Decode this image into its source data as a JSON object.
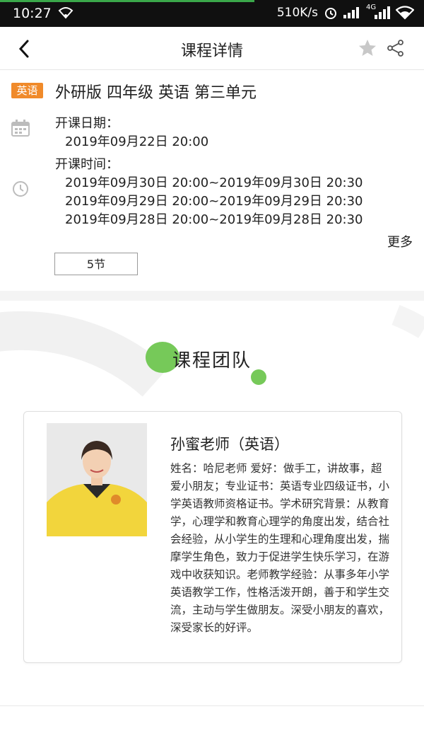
{
  "status_bar": {
    "time": "10:27",
    "network_speed": "510K/s",
    "signal_type": "4G",
    "icons": [
      "wifi-icon",
      "alarm-icon",
      "signal-icon",
      "signal-4g-icon",
      "wifi-icon"
    ]
  },
  "header": {
    "title": "课程详情",
    "back_icon": "chevron-left-icon",
    "favorite_icon": "star-icon",
    "share_icon": "share-icon"
  },
  "course": {
    "subject_badge": "英语",
    "title": "外研版 四年级 英语 第三单元",
    "start_date_label": "开课日期：",
    "start_date_value": "2019年09月22日 20:00",
    "time_label": "开课时间：",
    "schedule": [
      "2019年09月30日 20:00~2019年09月30日 20:30",
      "2019年09月29日 20:00~2019年09月29日 20:30",
      "2019年09月28日 20:00~2019年09月28日 20:30"
    ],
    "more_label": "更多",
    "lessons_label": "5节"
  },
  "team": {
    "title": "课程团队",
    "teacher": {
      "name": "孙蜜老师（英语）",
      "bio": "姓名：哈尼老师 爱好：做手工，讲故事，超爱小朋友；专业证书：英语专业四级证书，小学英语教师资格证书。学术研究背景：从教育学，心理学和教育心理学的角度出发，结合社会经验，从小学生的生理和心理角度出发，揣摩学生角色，致力于促进学生快乐学习，在游戏中收获知识。老师教学经验：从事多年小学英语教学工作，性格活泼开朗，善于和学生交流，主动与学生做朋友。深受小朋友的喜欢，深受家长的好评。"
    }
  },
  "colors": {
    "accent_green": "#76c959",
    "badge_orange": "#f08a2a",
    "status_bar_bg": "#101010"
  }
}
